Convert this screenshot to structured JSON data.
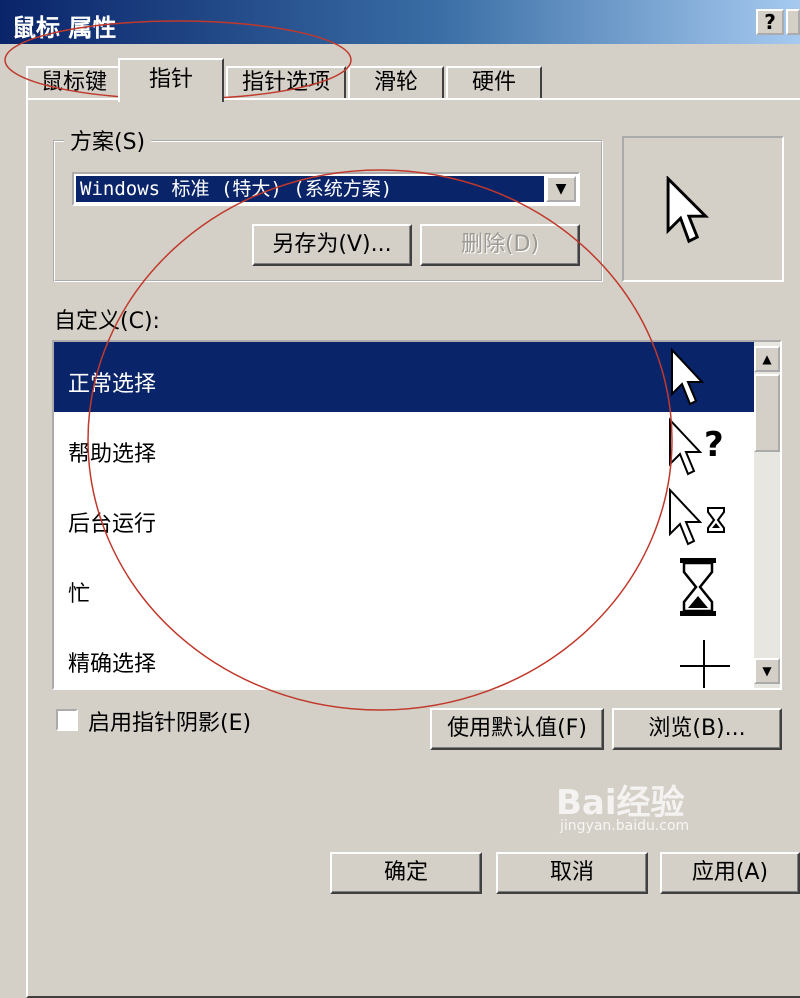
{
  "window": {
    "title": "鼠标 属性",
    "help_label": "?"
  },
  "tabs": [
    {
      "label": "鼠标键"
    },
    {
      "label": "指针"
    },
    {
      "label": "指针选项"
    },
    {
      "label": "滑轮"
    },
    {
      "label": "硬件"
    }
  ],
  "active_tab": "指针",
  "scheme": {
    "label": "方案(S)",
    "value": "Windows 标准 (特大) (系统方案)",
    "save_as_label": "另存为(V)...",
    "delete_label": "删除(D)"
  },
  "preview_icon": "arrow-cursor-icon",
  "customize": {
    "label": "自定义(C):",
    "items": [
      {
        "label": "正常选择",
        "icon": "arrow-cursor-icon",
        "selected": true
      },
      {
        "label": "帮助选择",
        "icon": "help-cursor-icon",
        "selected": false
      },
      {
        "label": "后台运行",
        "icon": "working-cursor-icon",
        "selected": false
      },
      {
        "label": "忙",
        "icon": "hourglass-icon",
        "selected": false
      },
      {
        "label": "精确选择",
        "icon": "crosshair-icon",
        "selected": false
      }
    ]
  },
  "shadow": {
    "label": "启用指针阴影(E)",
    "checked": false
  },
  "buttons": {
    "use_default": "使用默认值(F)",
    "browse": "浏览(B)...",
    "ok": "确定",
    "cancel": "取消",
    "apply": "应用(A)"
  },
  "watermark": {
    "text": "Bai经验",
    "sub": "jingyan.baidu.com"
  },
  "colors": {
    "selection": "#0a246a",
    "face": "#d4d0c8",
    "annotation": "#c0392b"
  }
}
